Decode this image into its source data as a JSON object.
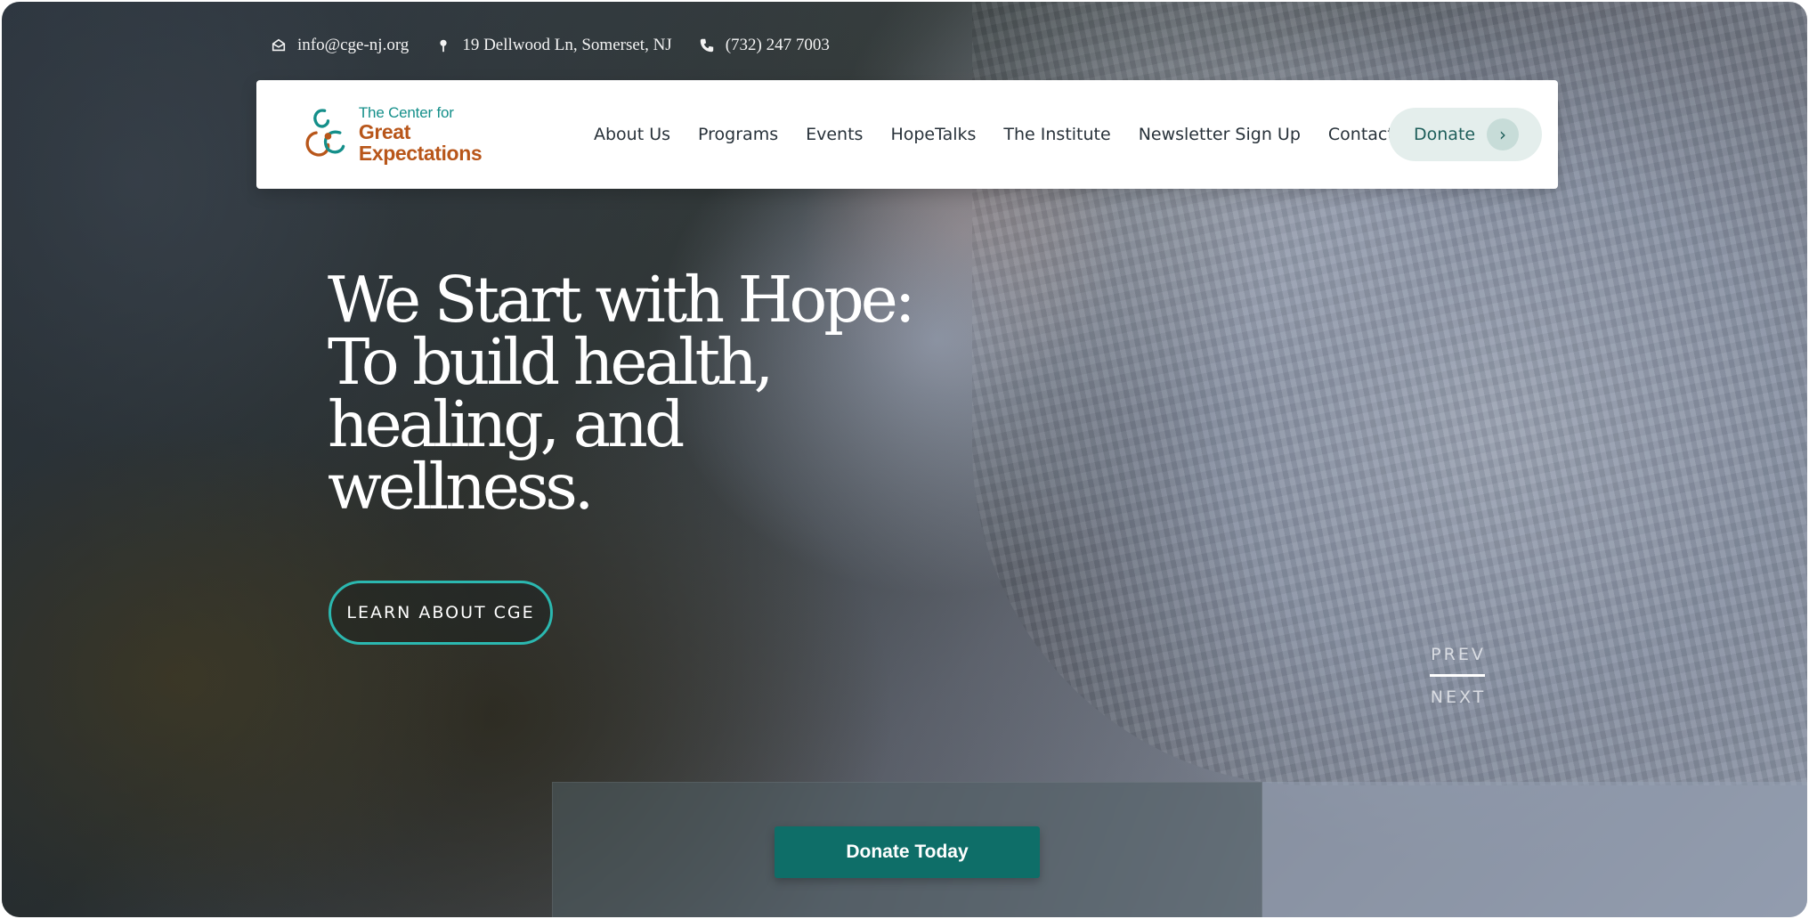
{
  "topbar": {
    "email": "info@cge-nj.org",
    "address": "19 Dellwood Ln, Somerset, NJ",
    "phone": "(732) 247 7003",
    "icons": [
      "envelope-icon",
      "map-pin-icon",
      "phone-icon"
    ]
  },
  "logo": {
    "line1": "The Center for",
    "line2": "Great Expectations"
  },
  "nav": {
    "items": [
      {
        "label": "About Us"
      },
      {
        "label": "Programs"
      },
      {
        "label": "Events"
      },
      {
        "label": "HopeTalks"
      },
      {
        "label": "The Institute"
      },
      {
        "label": "Newsletter Sign Up"
      },
      {
        "label": "Contact"
      }
    ],
    "donate_label": "Donate"
  },
  "hero": {
    "title_lines": [
      "We Start with Hope:",
      "To build health,",
      "healing, and",
      "wellness."
    ],
    "cta_label": "LEARN ABOUT CGE"
  },
  "slider": {
    "prev_label": "PREV",
    "next_label": "NEXT"
  },
  "bottom": {
    "donate_today_label": "Donate Today"
  },
  "colors": {
    "accent_teal": "#0e6e68",
    "outline_teal": "#2bb8b0",
    "logo_orange": "#b8561a",
    "logo_teal": "#148f8a"
  }
}
